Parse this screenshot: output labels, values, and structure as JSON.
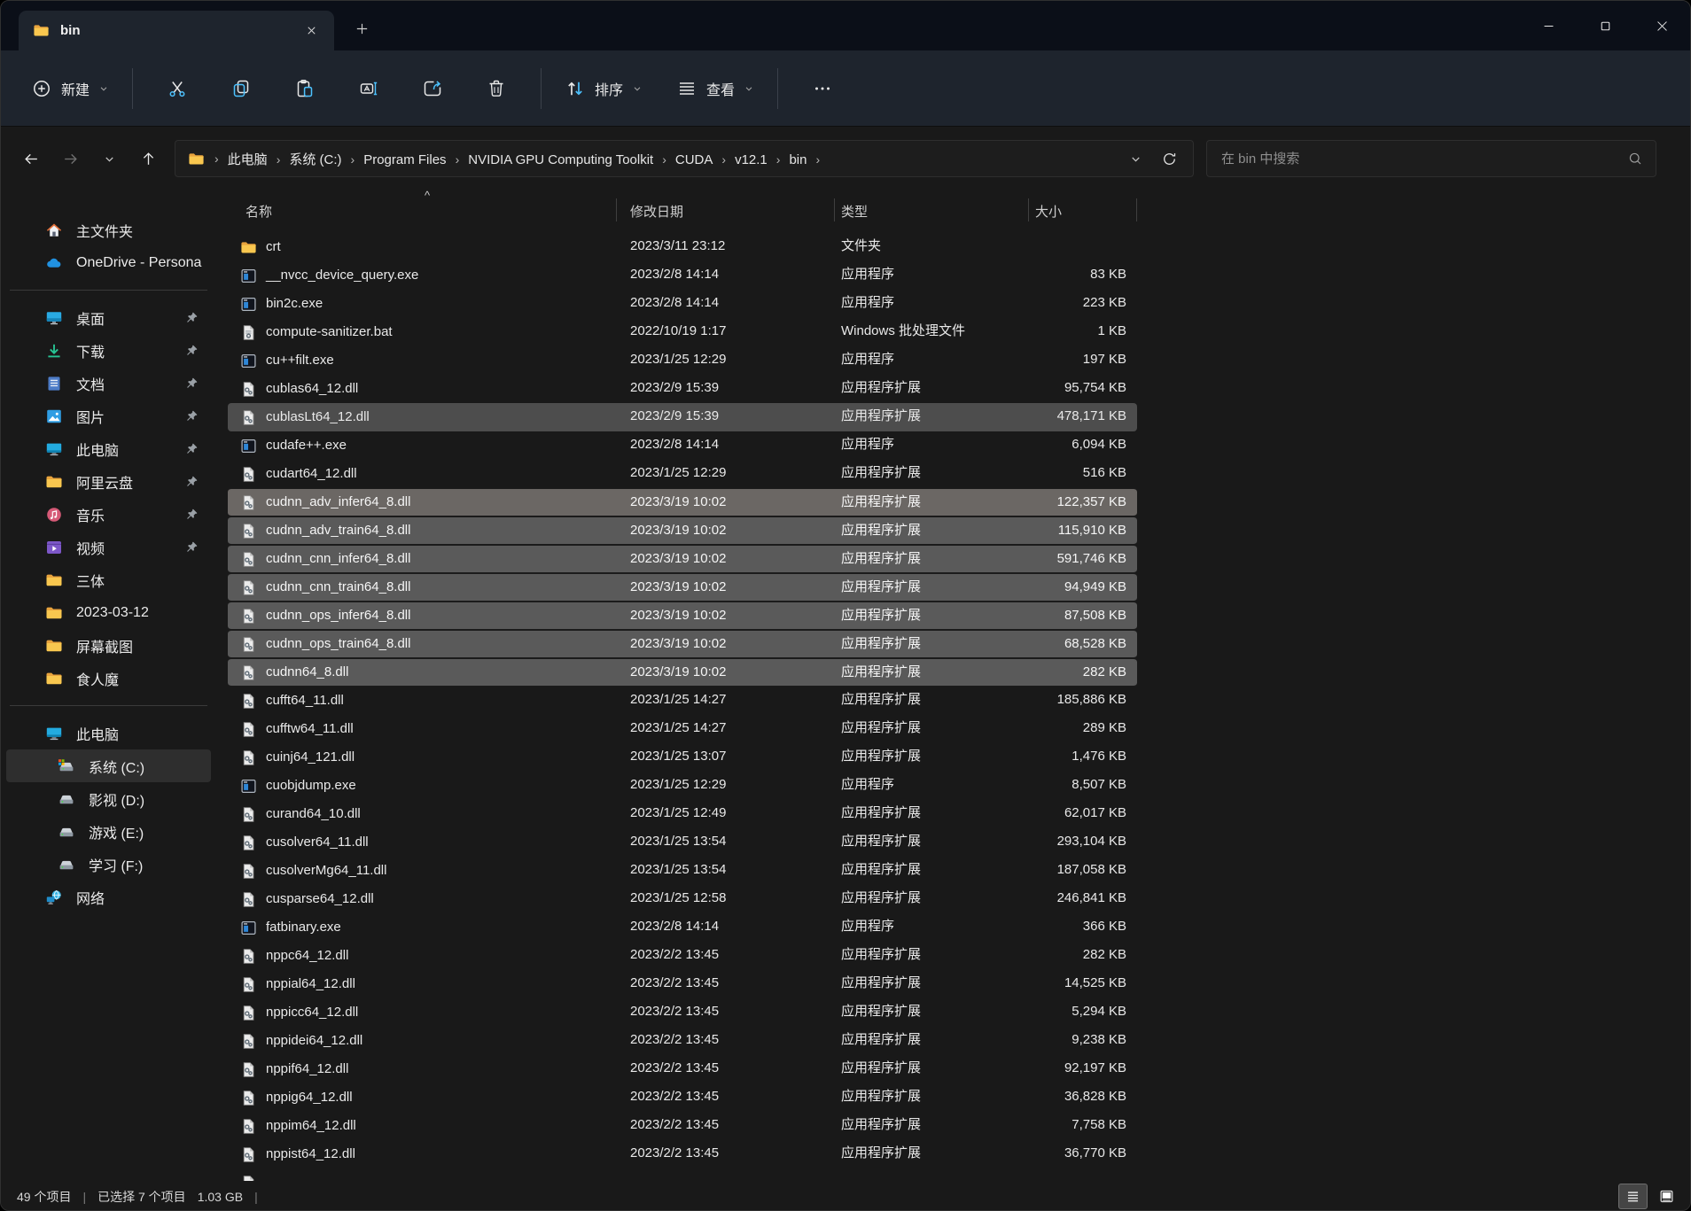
{
  "window": {
    "tab_title": "bin"
  },
  "colors": {
    "accent": "#4cc2ff",
    "titlebar_bg": "#0b0f18",
    "toolbar_bg": "#1e242d",
    "content_bg": "#191919",
    "selection_bg": "#5a5a5a",
    "hover_bg": "#4d4d4d",
    "folder_yellow": "#f9c74f"
  },
  "toolbar": {
    "new_label": "新建",
    "sort_label": "排序",
    "view_label": "查看"
  },
  "addressbar": {
    "crumb_separator": "›",
    "breadcrumbs": [
      "此电脑",
      "系统 (C:)",
      "Program Files",
      "NVIDIA GPU Computing Toolkit",
      "CUDA",
      "v12.1",
      "bin"
    ],
    "search_placeholder": "在 bin 中搜索"
  },
  "sidebar": {
    "top": [
      {
        "label": "主文件夹",
        "icon": "home",
        "pinned": false
      },
      {
        "label": "OneDrive - Persona",
        "icon": "onedrive",
        "pinned": false
      }
    ],
    "quick": [
      {
        "label": "桌面",
        "icon": "desktop",
        "pinned": true
      },
      {
        "label": "下载",
        "icon": "downloads",
        "pinned": true
      },
      {
        "label": "文档",
        "icon": "documents",
        "pinned": true
      },
      {
        "label": "图片",
        "icon": "pictures",
        "pinned": true
      },
      {
        "label": "此电脑",
        "icon": "thispc",
        "pinned": true
      },
      {
        "label": "阿里云盘",
        "icon": "folder",
        "pinned": true
      },
      {
        "label": "音乐",
        "icon": "music",
        "pinned": true
      },
      {
        "label": "视频",
        "icon": "videos",
        "pinned": true
      },
      {
        "label": "三体",
        "icon": "folder",
        "pinned": false
      },
      {
        "label": "2023-03-12",
        "icon": "folder",
        "pinned": false
      },
      {
        "label": "屏幕截图",
        "icon": "folder",
        "pinned": false
      },
      {
        "label": "食人魔",
        "icon": "folder",
        "pinned": false
      }
    ],
    "tree": [
      {
        "label": "此电脑",
        "icon": "thispc",
        "indent": 0,
        "selected": false
      },
      {
        "label": "系统 (C:)",
        "icon": "drive-c",
        "indent": 1,
        "selected": true
      },
      {
        "label": "影视 (D:)",
        "icon": "drive",
        "indent": 1,
        "selected": false
      },
      {
        "label": "游戏 (E:)",
        "icon": "drive",
        "indent": 1,
        "selected": false
      },
      {
        "label": "学习 (F:)",
        "icon": "drive",
        "indent": 1,
        "selected": false
      },
      {
        "label": "网络",
        "icon": "network",
        "indent": 0,
        "selected": false
      }
    ]
  },
  "filelist": {
    "columns": {
      "name": "名称",
      "date": "修改日期",
      "type": "类型",
      "size": "大小"
    },
    "sort_indicator": "^",
    "rows": [
      {
        "name": "crt",
        "date": "2023/3/11 23:12",
        "type": "文件夹",
        "size": "",
        "icon": "folder",
        "selected": false,
        "hover": false
      },
      {
        "name": "__nvcc_device_query.exe",
        "date": "2023/2/8 14:14",
        "type": "应用程序",
        "size": "83 KB",
        "icon": "exe",
        "selected": false,
        "hover": false
      },
      {
        "name": "bin2c.exe",
        "date": "2023/2/8 14:14",
        "type": "应用程序",
        "size": "223 KB",
        "icon": "exe",
        "selected": false,
        "hover": false
      },
      {
        "name": "compute-sanitizer.bat",
        "date": "2022/10/19 1:17",
        "type": "Windows 批处理文件",
        "size": "1 KB",
        "icon": "bat",
        "selected": false,
        "hover": false
      },
      {
        "name": "cu++filt.exe",
        "date": "2023/1/25 12:29",
        "type": "应用程序",
        "size": "197 KB",
        "icon": "exe",
        "selected": false,
        "hover": false
      },
      {
        "name": "cublas64_12.dll",
        "date": "2023/2/9 15:39",
        "type": "应用程序扩展",
        "size": "95,754 KB",
        "icon": "dll",
        "selected": false,
        "hover": false
      },
      {
        "name": "cublasLt64_12.dll",
        "date": "2023/2/9 15:39",
        "type": "应用程序扩展",
        "size": "478,171 KB",
        "icon": "dll",
        "selected": false,
        "hover": true
      },
      {
        "name": "cudafe++.exe",
        "date": "2023/2/8 14:14",
        "type": "应用程序",
        "size": "6,094 KB",
        "icon": "exe",
        "selected": false,
        "hover": false
      },
      {
        "name": "cudart64_12.dll",
        "date": "2023/1/25 12:29",
        "type": "应用程序扩展",
        "size": "516 KB",
        "icon": "dll",
        "selected": false,
        "hover": false
      },
      {
        "name": "cudnn_adv_infer64_8.dll",
        "date": "2023/3/19 10:02",
        "type": "应用程序扩展",
        "size": "122,357 KB",
        "icon": "dll",
        "selected": true,
        "hover": true
      },
      {
        "name": "cudnn_adv_train64_8.dll",
        "date": "2023/3/19 10:02",
        "type": "应用程序扩展",
        "size": "115,910 KB",
        "icon": "dll",
        "selected": true,
        "hover": false
      },
      {
        "name": "cudnn_cnn_infer64_8.dll",
        "date": "2023/3/19 10:02",
        "type": "应用程序扩展",
        "size": "591,746 KB",
        "icon": "dll",
        "selected": true,
        "hover": false
      },
      {
        "name": "cudnn_cnn_train64_8.dll",
        "date": "2023/3/19 10:02",
        "type": "应用程序扩展",
        "size": "94,949 KB",
        "icon": "dll",
        "selected": true,
        "hover": false
      },
      {
        "name": "cudnn_ops_infer64_8.dll",
        "date": "2023/3/19 10:02",
        "type": "应用程序扩展",
        "size": "87,508 KB",
        "icon": "dll",
        "selected": true,
        "hover": false
      },
      {
        "name": "cudnn_ops_train64_8.dll",
        "date": "2023/3/19 10:02",
        "type": "应用程序扩展",
        "size": "68,528 KB",
        "icon": "dll",
        "selected": true,
        "hover": false
      },
      {
        "name": "cudnn64_8.dll",
        "date": "2023/3/19 10:02",
        "type": "应用程序扩展",
        "size": "282 KB",
        "icon": "dll",
        "selected": true,
        "hover": false
      },
      {
        "name": "cufft64_11.dll",
        "date": "2023/1/25 14:27",
        "type": "应用程序扩展",
        "size": "185,886 KB",
        "icon": "dll",
        "selected": false,
        "hover": false
      },
      {
        "name": "cufftw64_11.dll",
        "date": "2023/1/25 14:27",
        "type": "应用程序扩展",
        "size": "289 KB",
        "icon": "dll",
        "selected": false,
        "hover": false
      },
      {
        "name": "cuinj64_121.dll",
        "date": "2023/1/25 13:07",
        "type": "应用程序扩展",
        "size": "1,476 KB",
        "icon": "dll",
        "selected": false,
        "hover": false
      },
      {
        "name": "cuobjdump.exe",
        "date": "2023/1/25 12:29",
        "type": "应用程序",
        "size": "8,507 KB",
        "icon": "exe",
        "selected": false,
        "hover": false
      },
      {
        "name": "curand64_10.dll",
        "date": "2023/1/25 12:49",
        "type": "应用程序扩展",
        "size": "62,017 KB",
        "icon": "dll",
        "selected": false,
        "hover": false
      },
      {
        "name": "cusolver64_11.dll",
        "date": "2023/1/25 13:54",
        "type": "应用程序扩展",
        "size": "293,104 KB",
        "icon": "dll",
        "selected": false,
        "hover": false
      },
      {
        "name": "cusolverMg64_11.dll",
        "date": "2023/1/25 13:54",
        "type": "应用程序扩展",
        "size": "187,058 KB",
        "icon": "dll",
        "selected": false,
        "hover": false
      },
      {
        "name": "cusparse64_12.dll",
        "date": "2023/1/25 12:58",
        "type": "应用程序扩展",
        "size": "246,841 KB",
        "icon": "dll",
        "selected": false,
        "hover": false
      },
      {
        "name": "fatbinary.exe",
        "date": "2023/2/8 14:14",
        "type": "应用程序",
        "size": "366 KB",
        "icon": "exe",
        "selected": false,
        "hover": false
      },
      {
        "name": "nppc64_12.dll",
        "date": "2023/2/2 13:45",
        "type": "应用程序扩展",
        "size": "282 KB",
        "icon": "dll",
        "selected": false,
        "hover": false
      },
      {
        "name": "nppial64_12.dll",
        "date": "2023/2/2 13:45",
        "type": "应用程序扩展",
        "size": "14,525 KB",
        "icon": "dll",
        "selected": false,
        "hover": false
      },
      {
        "name": "nppicc64_12.dll",
        "date": "2023/2/2 13:45",
        "type": "应用程序扩展",
        "size": "5,294 KB",
        "icon": "dll",
        "selected": false,
        "hover": false
      },
      {
        "name": "nppidei64_12.dll",
        "date": "2023/2/2 13:45",
        "type": "应用程序扩展",
        "size": "9,238 KB",
        "icon": "dll",
        "selected": false,
        "hover": false
      },
      {
        "name": "nppif64_12.dll",
        "date": "2023/2/2 13:45",
        "type": "应用程序扩展",
        "size": "92,197 KB",
        "icon": "dll",
        "selected": false,
        "hover": false
      },
      {
        "name": "nppig64_12.dll",
        "date": "2023/2/2 13:45",
        "type": "应用程序扩展",
        "size": "36,828 KB",
        "icon": "dll",
        "selected": false,
        "hover": false
      },
      {
        "name": "nppim64_12.dll",
        "date": "2023/2/2 13:45",
        "type": "应用程序扩展",
        "size": "7,758 KB",
        "icon": "dll",
        "selected": false,
        "hover": false
      },
      {
        "name": "nppist64_12.dll",
        "date": "2023/2/2 13:45",
        "type": "应用程序扩展",
        "size": "36,770 KB",
        "icon": "dll",
        "selected": false,
        "hover": false
      },
      {
        "name": "",
        "date": "",
        "type": "",
        "size": "",
        "icon": "dll",
        "selected": false,
        "hover": false,
        "partial": true
      }
    ]
  },
  "statusbar": {
    "items_count": "49 个项目",
    "divider": "|",
    "selection_count": "已选择 7 个项目",
    "selection_size": "1.03 GB"
  }
}
